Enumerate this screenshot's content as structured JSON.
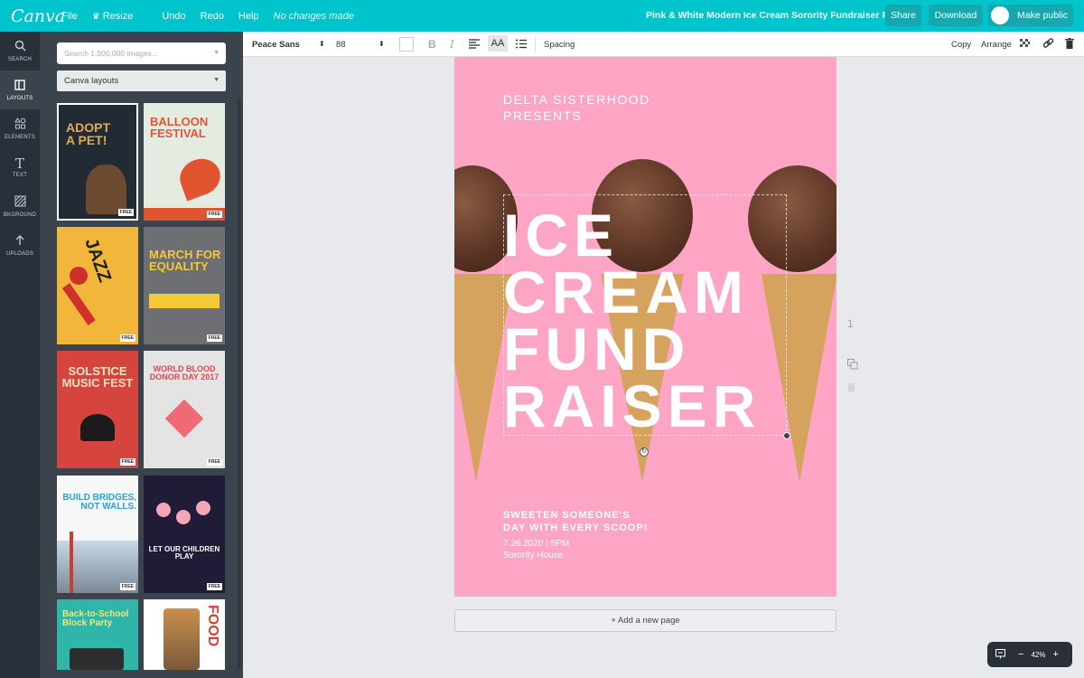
{
  "app": {
    "logo": "Canva"
  },
  "menu": {
    "file": "File",
    "resize": "Resize",
    "undo": "Undo",
    "redo": "Redo",
    "help": "Help",
    "status": "No changes made"
  },
  "document": {
    "title": "Pink & White Modern Ice Cream Sorority Fundraiser Poster"
  },
  "actions": {
    "share": "Share",
    "download": "Download",
    "make_public": "Make public"
  },
  "rail": [
    {
      "label": "SEARCH",
      "icon": "search-icon"
    },
    {
      "label": "LAYOUTS",
      "icon": "layouts-icon"
    },
    {
      "label": "ELEMENTS",
      "icon": "elements-icon"
    },
    {
      "label": "TEXT",
      "icon": "text-icon"
    },
    {
      "label": "BKGROUND",
      "icon": "background-icon"
    },
    {
      "label": "UPLOADS",
      "icon": "upload-icon"
    }
  ],
  "panel": {
    "search_placeholder": "Search 1,000,000 images...",
    "layout_select": "Canva layouts",
    "free_badge": "FREE",
    "templates": [
      {
        "title": "ADOPT A PET!",
        "bg": "#222a33",
        "color": "#e3ab4b"
      },
      {
        "title": "BALLOON FESTIVAL",
        "bg": "#e4ece2",
        "color": "#e2542f"
      },
      {
        "title": "JAZZ",
        "bg": "#f2b63b",
        "color": "#1f1f1f"
      },
      {
        "title": "MARCH FOR EQUALITY",
        "bg": "#6d6f72",
        "color": "#f5c937"
      },
      {
        "title": "SOLSTICE MUSIC FEST",
        "bg": "#d6453d",
        "color": "#fbe4c9"
      },
      {
        "title": "WORLD BLOOD DONOR DAY 2017",
        "bg": "#e4e4e4",
        "color": "#e2474d"
      },
      {
        "title": "BUILD BRIDGES, NOT WALLS.",
        "bg": "#f7f7f7",
        "color": "#2aa0d6"
      },
      {
        "title": "LET OUR CHILDREN PLAY",
        "bg": "#201b36",
        "color": "#ffffff"
      },
      {
        "title": "Back-to-School Block Party",
        "bg": "#2fb6a8",
        "color": "#fce36a"
      },
      {
        "title": "FOOD",
        "bg": "#ffffff",
        "color": "#d94032"
      }
    ]
  },
  "toolbar": {
    "font": "Peace Sans",
    "size": "88",
    "spacing": "Spacing",
    "copy": "Copy",
    "arrange": "Arrange"
  },
  "poster": {
    "presents_line1": "DELTA SISTERHOOD",
    "presents_line2": "PRESENTS",
    "title_lines": [
      "ICE",
      "CREAM",
      "FUND",
      "RAISER"
    ],
    "subtitle_line1": "SWEETEN SOMEONE'S",
    "subtitle_line2": "DAY WITH EVERY SCOOP!",
    "date": "7.26.2020 | 5PM",
    "location": "Sorority House",
    "background": "#fea4c5"
  },
  "canvas": {
    "add_page": "+ Add a new page",
    "page_number": "1"
  },
  "zoom": {
    "level": "42%"
  }
}
